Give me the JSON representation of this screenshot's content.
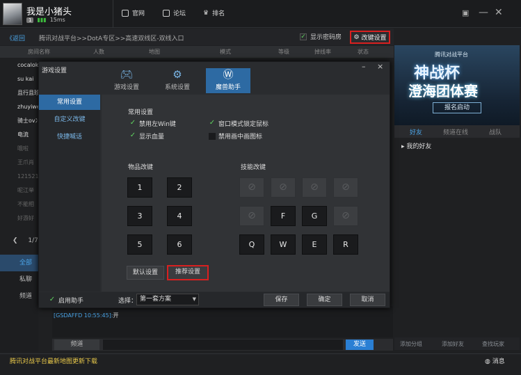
{
  "user": {
    "name": "我是小猪头",
    "level": "1",
    "signal": "15ms"
  },
  "topnav": [
    {
      "label": "官网"
    },
    {
      "label": "论坛"
    },
    {
      "label": "排名"
    }
  ],
  "window": {
    "menu": "▣",
    "minimize": "—",
    "close": "✕"
  },
  "breadcrumb": {
    "back": "《返回",
    "path": "腾讯对战平台>>DotA专区>>高速双线区-双线入口"
  },
  "room_options": {
    "show_password": "显示密码房",
    "key_settings": "改键设置"
  },
  "table_header": [
    "房间名称",
    "人数",
    "地图",
    "模式",
    "等级",
    "掉线率",
    "状态"
  ],
  "rooms": [
    "cocalok",
    "su kai",
    "且行且珍",
    "zhuyiwei",
    "骑士ov冫",
    "电流",
    "哦啦",
    "王爪肖",
    "121521",
    "呢江举",
    "不能相",
    "好游好"
  ],
  "pager": {
    "prev": "❮",
    "page": "1/7"
  },
  "chat_tabs": [
    "全部",
    "私聊",
    "频道"
  ],
  "chat": {
    "line_sender": "[GSDAFFD 10:55:45]:",
    "line_text": "开",
    "channel": "频道",
    "send": "发送"
  },
  "banner": {
    "platform": "腾讯对战平台",
    "title1": "神战杯",
    "title2": "澄海团体赛",
    "cta": "报名启动"
  },
  "friend_tabs": [
    "好友",
    "频道在线",
    "战队"
  ],
  "friends": {
    "group": "我的好友"
  },
  "right_bottom": [
    "添加分组",
    "添加好友",
    "查找玩家"
  ],
  "status": {
    "text": "腾讯对战平台最新地图更新下载",
    "messages": "消息"
  },
  "dialog": {
    "title": "游戏设置",
    "tabs": [
      {
        "label": "游戏设置",
        "icon": "gamepad-icon"
      },
      {
        "label": "系统设置",
        "icon": "gear-icon"
      },
      {
        "label": "魔兽助手",
        "icon": "warcraft-icon"
      }
    ],
    "side": [
      "常用设置",
      "自定义改键",
      "快捷喊话"
    ],
    "general_title": "常用设置",
    "options": [
      {
        "label": "禁用左Win键",
        "checked": true
      },
      {
        "label": "窗口模式锁定鼠标",
        "checked": true
      },
      {
        "label": "显示血量",
        "checked": true
      },
      {
        "label": "禁用画中画图标",
        "checked": false
      }
    ],
    "item_title": "物品改键",
    "item_keys": [
      "1",
      "2",
      "3",
      "4",
      "5",
      "6"
    ],
    "skill_title": "技能改键",
    "skill_keys": [
      "",
      "",
      "",
      "",
      "",
      "F",
      "G",
      "",
      "Q",
      "W",
      "E",
      "R"
    ],
    "default_btn": "默认设置",
    "recommend_btn": "推荐设置",
    "enable_label": "启用助手",
    "scheme_label": "选择：",
    "scheme_value": "第一套方案",
    "save": "保存",
    "ok": "确定",
    "cancel": "取消"
  },
  "colors": {
    "accent": "#2d6aa3",
    "link": "#4aa3e5",
    "highlight": "#d92020"
  }
}
